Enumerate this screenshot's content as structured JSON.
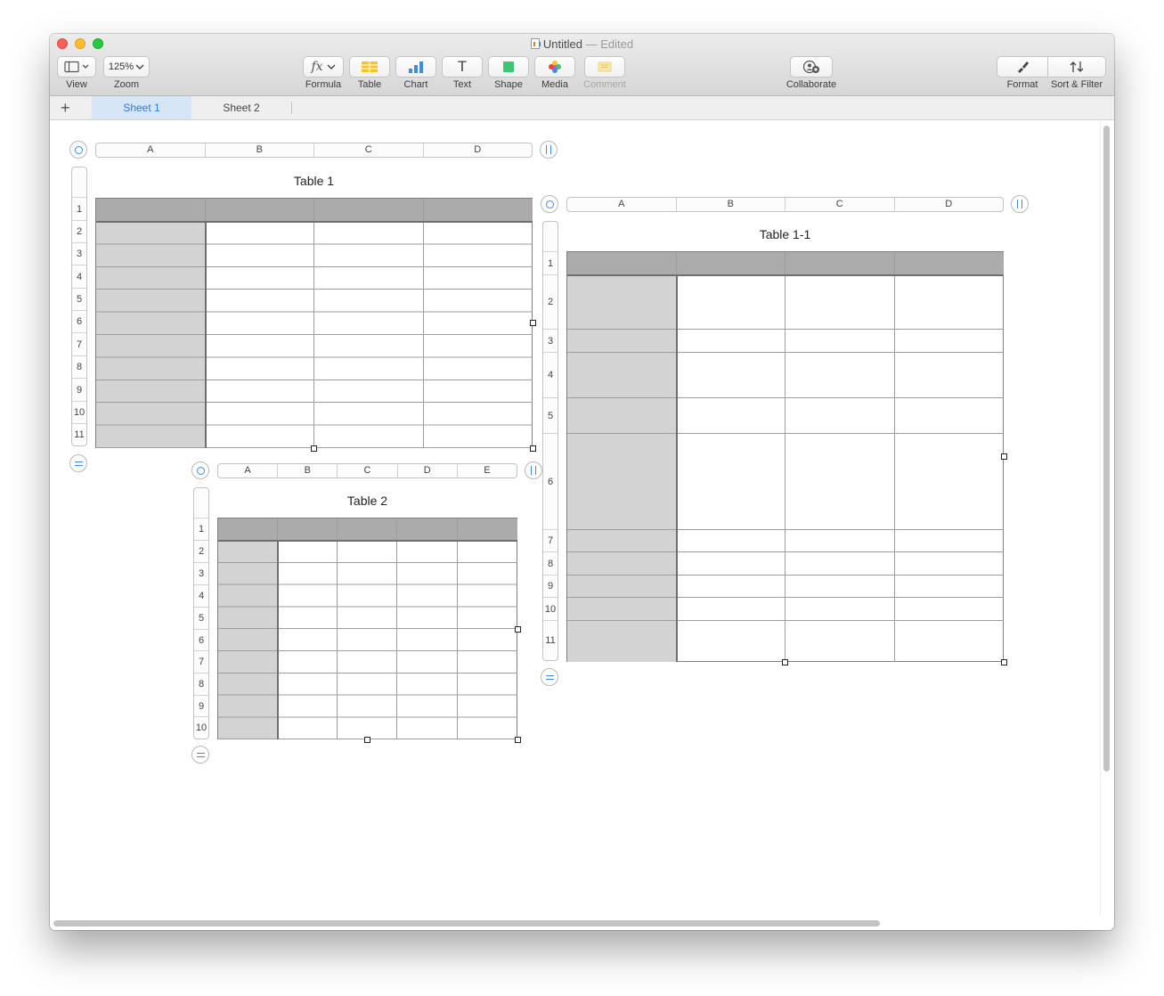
{
  "window": {
    "title": "Untitled",
    "status": "— Edited"
  },
  "toolbar": {
    "view_label": "View",
    "zoom_value": "125%",
    "zoom_label": "Zoom",
    "formula_label": "Formula",
    "table_label": "Table",
    "chart_label": "Chart",
    "text_label": "Text",
    "shape_label": "Shape",
    "media_label": "Media",
    "comment_label": "Comment",
    "collaborate_label": "Collaborate",
    "format_label": "Format",
    "sort_filter_label": "Sort & Filter",
    "formula_icon_text": "fx",
    "text_icon_text": "T"
  },
  "sheets": {
    "add_label": "+",
    "tabs": [
      "Sheet 1",
      "Sheet 2"
    ],
    "active": "Sheet 1"
  },
  "tables": {
    "table1": {
      "title": "Table 1",
      "columns": [
        "A",
        "B",
        "C",
        "D"
      ],
      "rows": [
        "1",
        "2",
        "3",
        "4",
        "5",
        "6",
        "7",
        "8",
        "9",
        "10",
        "11"
      ]
    },
    "table11": {
      "title": "Table 1-1",
      "columns": [
        "A",
        "B",
        "C",
        "D"
      ],
      "rows": [
        "1",
        "2",
        "3",
        "4",
        "5",
        "6",
        "7",
        "8",
        "9",
        "10",
        "11"
      ]
    },
    "table2": {
      "title": "Table 2",
      "columns": [
        "A",
        "B",
        "C",
        "D",
        "E"
      ],
      "rows": [
        "1",
        "2",
        "3",
        "4",
        "5",
        "6",
        "7",
        "8",
        "9",
        "10"
      ]
    }
  },
  "colors": {
    "accent": "#2b7be4",
    "header_row": "#ababab",
    "header_col": "#d3d3d3",
    "active_tab_bg": "#d6e6f7"
  }
}
